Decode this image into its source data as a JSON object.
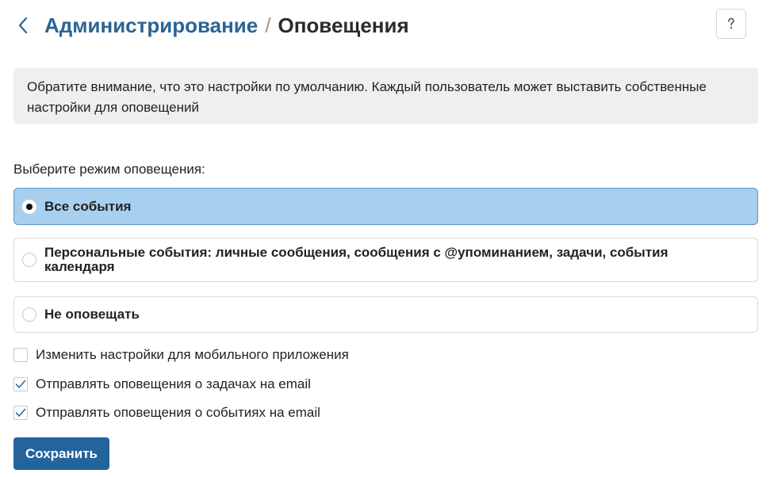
{
  "header": {
    "back_icon": "chevron-left-icon",
    "breadcrumb_parent": "Администрирование",
    "separator": "/",
    "title": "Оповещения",
    "help_icon": "question-icon",
    "accent_color": "#2a6496"
  },
  "notice": {
    "text": "Обратите внимание, что это настройки по умолчанию. Каждый пользователь может выставить собственные настройки для оповещений"
  },
  "mode": {
    "label": "Выберите режим оповещения:",
    "options": [
      {
        "label": "Все события",
        "selected": true
      },
      {
        "label": "Персональные события: личные сообщения, сообщения с @упоминанием, задачи, события календаря",
        "selected": false
      },
      {
        "label": "Не оповещать",
        "selected": false
      }
    ],
    "selected_color": "#a9cfee"
  },
  "checkboxes": [
    {
      "label": "Изменить настройки для мобильного приложения",
      "checked": false
    },
    {
      "label": "Отправлять оповещения о задачах на email",
      "checked": true
    },
    {
      "label": "Отправлять оповещения о событиях на email",
      "checked": true
    }
  ],
  "actions": {
    "save_label": "Сохранить",
    "button_color": "#23649c"
  }
}
